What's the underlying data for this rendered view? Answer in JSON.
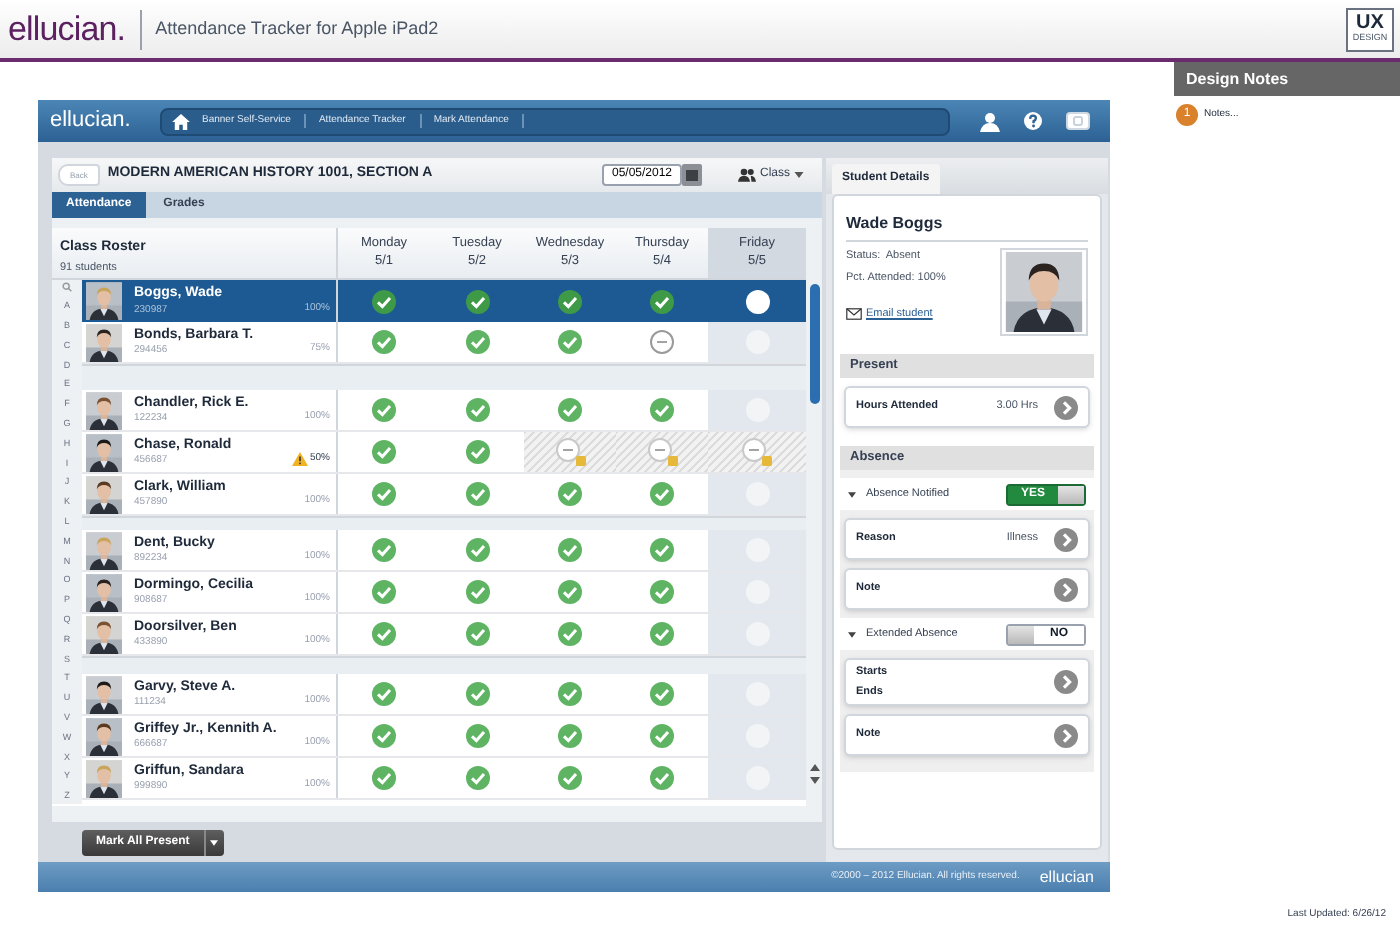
{
  "header": {
    "logo": "ellucian.",
    "title": "Attendance Tracker for Apple iPad2",
    "badge": "UX",
    "badge_caption": "DESIGN"
  },
  "design_notes": {
    "title": "Design Notes",
    "notes": [
      {
        "number": "1",
        "text": "Notes..."
      }
    ]
  },
  "app": {
    "logo": "ellucian.",
    "breadcrumbs": [
      "Banner Self-Service",
      "Attendance Tracker",
      "Mark Attendance"
    ],
    "back_button": "Back",
    "course_title": "MODERN AMERICAN HISTORY 1001, SECTION A",
    "date": "05/05/2012",
    "class_button": "Class",
    "tabs": [
      {
        "label": "Attendance",
        "selected": true
      },
      {
        "label": "Grades",
        "selected": false
      }
    ],
    "roster": {
      "title": "Class Roster",
      "count": "91 students",
      "days": [
        {
          "day": "Monday",
          "date": "5/1",
          "selected": false
        },
        {
          "day": "Tuesday",
          "date": "5/2",
          "selected": false
        },
        {
          "day": "Wednesday",
          "date": "5/3",
          "selected": false
        },
        {
          "day": "Thursday",
          "date": "5/4",
          "selected": false
        },
        {
          "day": "Friday",
          "date": "5/5",
          "selected": true
        }
      ],
      "index": [
        "A",
        "B",
        "C",
        "D",
        "E",
        "F",
        "G",
        "H",
        "I",
        "J",
        "K",
        "L",
        "M",
        "N",
        "O",
        "P",
        "Q",
        "R",
        "S",
        "T",
        "U",
        "V",
        "W",
        "X",
        "Y",
        "Z"
      ],
      "groups": [
        {
          "students": [
            {
              "name": "Boggs, Wade",
              "id": "230987",
              "percent": "100%",
              "selected": true,
              "warning": false,
              "cells": [
                {
                  "kind": "present"
                },
                {
                  "kind": "present"
                },
                {
                  "kind": "present"
                },
                {
                  "kind": "present"
                },
                {
                  "kind": "none"
                }
              ]
            },
            {
              "name": "Bonds, Barbara T.",
              "id": "294456",
              "percent": "75%",
              "selected": false,
              "warning": false,
              "cells": [
                {
                  "kind": "present"
                },
                {
                  "kind": "present"
                },
                {
                  "kind": "present"
                },
                {
                  "kind": "absent"
                },
                {
                  "kind": "none"
                }
              ]
            }
          ]
        },
        {
          "students": [
            {
              "name": "Chandler, Rick E.",
              "id": "122234",
              "percent": "100%",
              "selected": false,
              "warning": false,
              "cells": [
                {
                  "kind": "present"
                },
                {
                  "kind": "present"
                },
                {
                  "kind": "present"
                },
                {
                  "kind": "present"
                },
                {
                  "kind": "none"
                }
              ]
            },
            {
              "name": "Chase, Ronald",
              "id": "456687",
              "percent": "50%",
              "selected": false,
              "warning": true,
              "cells": [
                {
                  "kind": "present"
                },
                {
                  "kind": "present"
                },
                {
                  "kind": "excused"
                },
                {
                  "kind": "excused"
                },
                {
                  "kind": "excused"
                }
              ]
            },
            {
              "name": "Clark, William",
              "id": "457890",
              "percent": "100%",
              "selected": false,
              "warning": false,
              "cells": [
                {
                  "kind": "present"
                },
                {
                  "kind": "present"
                },
                {
                  "kind": "present"
                },
                {
                  "kind": "present"
                },
                {
                  "kind": "none"
                }
              ]
            }
          ]
        },
        {
          "students": [
            {
              "name": "Dent, Bucky",
              "id": "892234",
              "percent": "100%",
              "selected": false,
              "warning": false,
              "cells": [
                {
                  "kind": "present"
                },
                {
                  "kind": "present"
                },
                {
                  "kind": "present"
                },
                {
                  "kind": "present"
                },
                {
                  "kind": "none"
                }
              ]
            },
            {
              "name": "Dormingo, Cecilia",
              "id": "908687",
              "percent": "100%",
              "selected": false,
              "warning": false,
              "cells": [
                {
                  "kind": "present"
                },
                {
                  "kind": "present"
                },
                {
                  "kind": "present"
                },
                {
                  "kind": "present"
                },
                {
                  "kind": "none"
                }
              ]
            },
            {
              "name": "Doorsilver, Ben",
              "id": "433890",
              "percent": "100%",
              "selected": false,
              "warning": false,
              "cells": [
                {
                  "kind": "present"
                },
                {
                  "kind": "present"
                },
                {
                  "kind": "present"
                },
                {
                  "kind": "present"
                },
                {
                  "kind": "none"
                }
              ]
            }
          ]
        },
        {
          "students": [
            {
              "name": "Garvy, Steve A.",
              "id": "111234",
              "percent": "100%",
              "selected": false,
              "warning": false,
              "cells": [
                {
                  "kind": "present"
                },
                {
                  "kind": "present"
                },
                {
                  "kind": "present"
                },
                {
                  "kind": "present"
                },
                {
                  "kind": "none"
                }
              ]
            },
            {
              "name": "Griffey  Jr., Kennith A.",
              "id": "666687",
              "percent": "100%",
              "selected": false,
              "warning": false,
              "cells": [
                {
                  "kind": "present"
                },
                {
                  "kind": "present"
                },
                {
                  "kind": "present"
                },
                {
                  "kind": "present"
                },
                {
                  "kind": "none"
                }
              ]
            },
            {
              "name": "Griffun, Sandara",
              "id": "999890",
              "percent": "100%",
              "selected": false,
              "warning": false,
              "cells": [
                {
                  "kind": "present"
                },
                {
                  "kind": "present"
                },
                {
                  "kind": "present"
                },
                {
                  "kind": "present"
                },
                {
                  "kind": "none"
                }
              ]
            }
          ]
        }
      ]
    },
    "mark_all_button": "Mark All Present",
    "footer": "©2000 – 2012 Ellucian. All rights reserved.",
    "footer_logo": "ellucian"
  },
  "details": {
    "tab": "Student Details",
    "name": "Wade Boggs",
    "status": "Status:  Absent",
    "attended": "Pct. Attended: 100%",
    "email_link": "Email student",
    "sections": [
      {
        "title": "Present",
        "items": [
          {
            "kind": "card",
            "lines": [
              "Hours Attended"
            ],
            "value": "3.00 Hrs"
          }
        ]
      },
      {
        "title": "Absence",
        "items": [
          {
            "kind": "toggle",
            "label": "Absence Notified",
            "on": true,
            "text": "YES"
          },
          {
            "kind": "card",
            "lines": [
              "Reason"
            ],
            "value": "Illness"
          },
          {
            "kind": "card",
            "lines": [
              "Note"
            ]
          },
          {
            "kind": "toggle",
            "label": "Extended Absence",
            "on": false,
            "text": "NO"
          },
          {
            "kind": "card",
            "lines": [
              "Starts",
              "Ends"
            ]
          },
          {
            "kind": "card",
            "lines": [
              "Note"
            ]
          }
        ]
      }
    ]
  },
  "last_updated": "Last Updated: 6/26/12"
}
